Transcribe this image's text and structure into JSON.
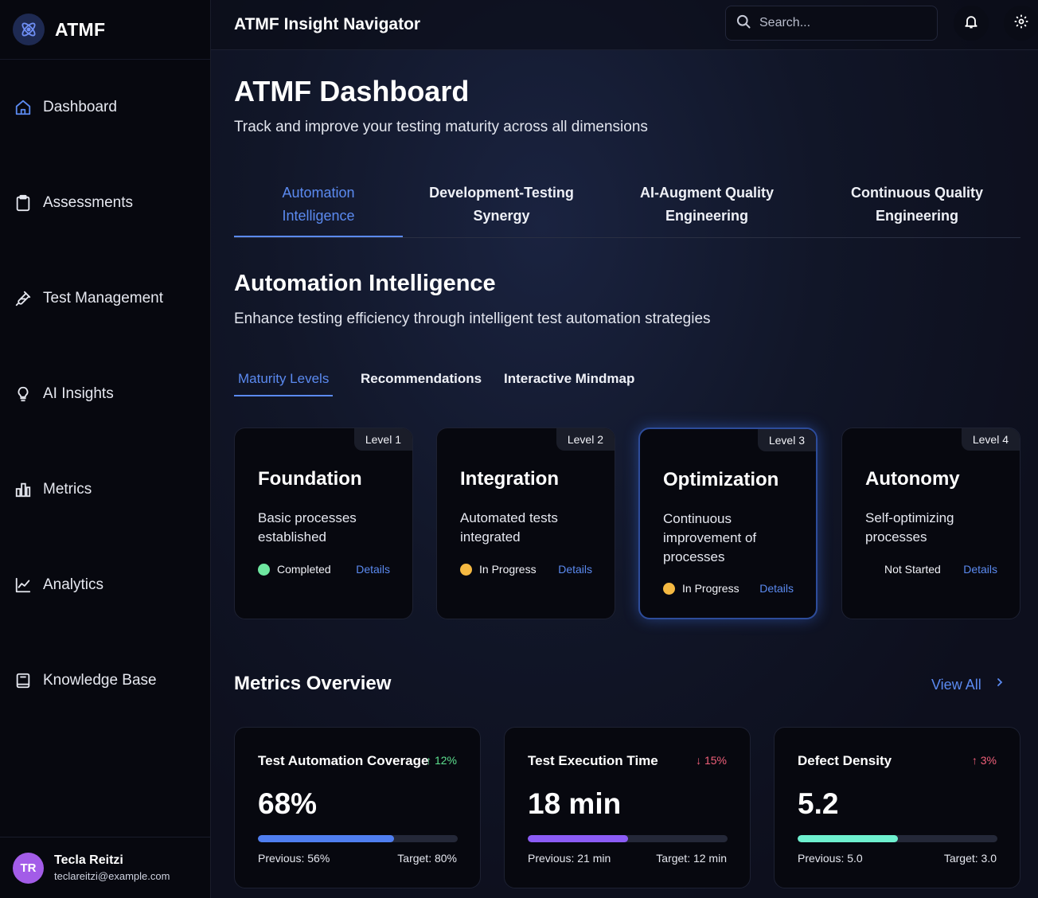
{
  "brand": {
    "name": "ATMF"
  },
  "sidebar": {
    "items": [
      {
        "label": "Dashboard",
        "icon": "home-icon"
      },
      {
        "label": "Assessments",
        "icon": "clipboard-icon"
      },
      {
        "label": "Test Management",
        "icon": "flask-icon"
      },
      {
        "label": "AI Insights",
        "icon": "lightbulb-icon"
      },
      {
        "label": "Metrics",
        "icon": "bar-chart-icon"
      },
      {
        "label": "Analytics",
        "icon": "line-chart-icon"
      },
      {
        "label": "Knowledge Base",
        "icon": "book-icon"
      }
    ],
    "user": {
      "initials": "TR",
      "name": "Tecla Reitzi",
      "email": "teclareitzi@example.com"
    }
  },
  "header": {
    "title": "ATMF Insight Navigator",
    "search_placeholder": "Search..."
  },
  "page": {
    "title": "ATMF Dashboard",
    "subtitle": "Track and improve your testing maturity across all dimensions"
  },
  "dimension_tabs": [
    {
      "line1": "Automation",
      "line2": "Intelligence",
      "active": true
    },
    {
      "line1": "Development-Testing",
      "line2": "Synergy",
      "active": false
    },
    {
      "line1": "AI-Augment Quality",
      "line2": "Engineering",
      "active": false
    },
    {
      "line1": "Continuous Quality",
      "line2": "Engineering",
      "active": false
    }
  ],
  "section": {
    "title": "Automation Intelligence",
    "subtitle": "Enhance testing efficiency through intelligent test automation strategies"
  },
  "sub_tabs": [
    {
      "label": "Maturity Levels",
      "active": true
    },
    {
      "label": "Recommendations",
      "active": false
    },
    {
      "label": "Interactive Mindmap",
      "active": false
    }
  ],
  "levels": [
    {
      "badge": "Level 1",
      "title": "Foundation",
      "desc": "Basic processes established",
      "status": "Completed",
      "status_color": "#6ee7a0",
      "details": "Details"
    },
    {
      "badge": "Level 2",
      "title": "Integration",
      "desc": "Automated tests integrated",
      "status": "In Progress",
      "status_color": "#f5b942",
      "details": "Details"
    },
    {
      "badge": "Level 3",
      "title": "Optimization",
      "desc": "Continuous improvement of processes",
      "status": "In Progress",
      "status_color": "#f5b942",
      "details": "Details"
    },
    {
      "badge": "Level 4",
      "title": "Autonomy",
      "desc": "Self-optimizing processes",
      "status": "Not Started",
      "status_color": "",
      "details": "Details"
    }
  ],
  "metrics": {
    "title": "Metrics Overview",
    "view_all": "View All",
    "cards": [
      {
        "label": "Test Automation Coverage",
        "change": "↑ 12%",
        "change_color": "#5ee08f",
        "value": "68%",
        "progress": 0.68,
        "bar_color": "#4f7ef0",
        "previous": "Previous: 56%",
        "target": "Target: 80%"
      },
      {
        "label": "Test Execution Time",
        "change": "↓ 15%",
        "change_color": "#f0607a",
        "value": "18 min",
        "progress": 0.5,
        "bar_color": "#8b5cf6",
        "previous": "Previous: 21 min",
        "target": "Target: 12 min"
      },
      {
        "label": "Defect Density",
        "change": "↑ 3%",
        "change_color": "#f0607a",
        "value": "5.2",
        "progress": 0.5,
        "bar_color": "#6ef0cf",
        "previous": "Previous: 5.0",
        "target": "Target: 3.0"
      }
    ]
  },
  "colors": {
    "accent": "#5b8af0",
    "avatar": "#a35ce8"
  }
}
